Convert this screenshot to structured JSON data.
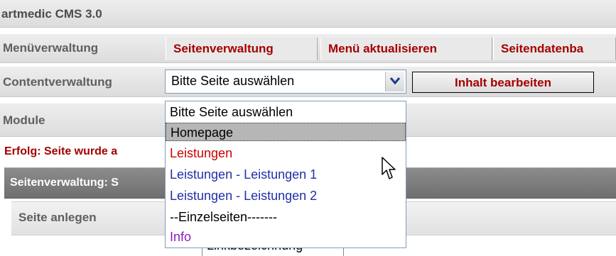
{
  "app": {
    "title": "artmedic CMS 3.0"
  },
  "menu_row": {
    "label": "Menüverwaltung",
    "buttons": [
      "Seitenverwaltung",
      "Menü aktualisieren",
      "Seitendatenba"
    ]
  },
  "content_row": {
    "label": "Contentverwaltung",
    "select": {
      "selected": "Bitte Seite auswählen"
    },
    "edit_button": "Inhalt bearbeiten"
  },
  "module_row": {
    "label": "Module"
  },
  "dropdown": {
    "options": [
      {
        "label": "Bitte Seite auswählen",
        "color": "#000000"
      },
      {
        "label": "Homepage",
        "color": "#000000",
        "selected": true
      },
      {
        "label": "Leistungen",
        "color": "#cc0000"
      },
      {
        "label": "Leistungen - Leistungen 1",
        "color": "#1f2fa8"
      },
      {
        "label": "Leistungen - Leistungen 2",
        "color": "#1f2fa8"
      },
      {
        "label": "--Einzelseiten-------",
        "color": "#000000"
      },
      {
        "label": "Info",
        "color": "#8a1cc2"
      }
    ]
  },
  "status": {
    "success": "Erfolg: Seite wurde a"
  },
  "section": {
    "title": "Seitenverwaltung: S"
  },
  "panel": {
    "title": "Seite anlegen"
  },
  "form": {
    "field_label": "Linkbezeichnung"
  },
  "colors": {
    "accent": "#a40000",
    "select_border": "#7f9db9"
  }
}
